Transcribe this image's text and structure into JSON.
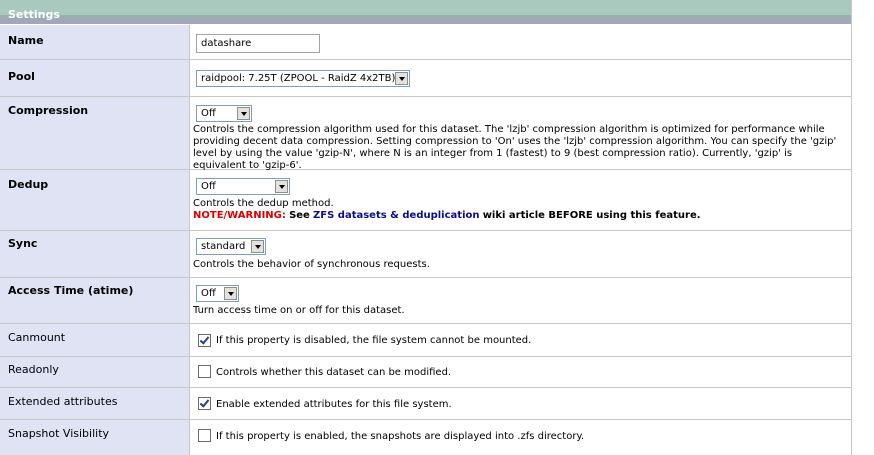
{
  "header": {
    "title": "Settings"
  },
  "rows": {
    "name": {
      "label": "Name",
      "value": "datashare"
    },
    "pool": {
      "label": "Pool",
      "selected": "raidpool: 7.25T (ZPOOL - RaidZ 4x2TB)"
    },
    "compression": {
      "label": "Compression",
      "selected": "Off",
      "help": "Controls the compression algorithm used for this dataset. The 'lzjb' compression algorithm is optimized for performance while providing decent data compression. Setting compression to 'On' uses the 'lzjb' compression algorithm. You can specify the 'gzip' level by using the value 'gzip-N', where N is an integer from 1 (fastest) to 9 (best compression ratio). Currently, 'gzip' is equivalent to 'gzip-6'."
    },
    "dedup": {
      "label": "Dedup",
      "selected": "Off",
      "help": "Controls the dedup method.",
      "warning_label": "NOTE/WARNING:",
      "warning_see": "See",
      "warning_link": "ZFS datasets & deduplication",
      "warning_rest": "wiki article BEFORE using this feature."
    },
    "sync": {
      "label": "Sync",
      "selected": "standard",
      "help": "Controls the behavior of synchronous requests."
    },
    "atime": {
      "label": "Access Time (atime)",
      "selected": "Off",
      "help": "Turn access time on or off for this dataset."
    },
    "canmount": {
      "label": "Canmount",
      "checked": true,
      "help": "If this property is disabled, the file system cannot be mounted."
    },
    "readonly": {
      "label": "Readonly",
      "checked": false,
      "help": "Controls whether this dataset can be modified."
    },
    "xattr": {
      "label": "Extended attributes",
      "checked": true,
      "help": "Enable extended attributes for this file system."
    },
    "snapdir": {
      "label": "Snapshot Visibility",
      "checked": false,
      "help": "If this property is enabled, the snapshots are displayed into .zfs directory."
    }
  }
}
